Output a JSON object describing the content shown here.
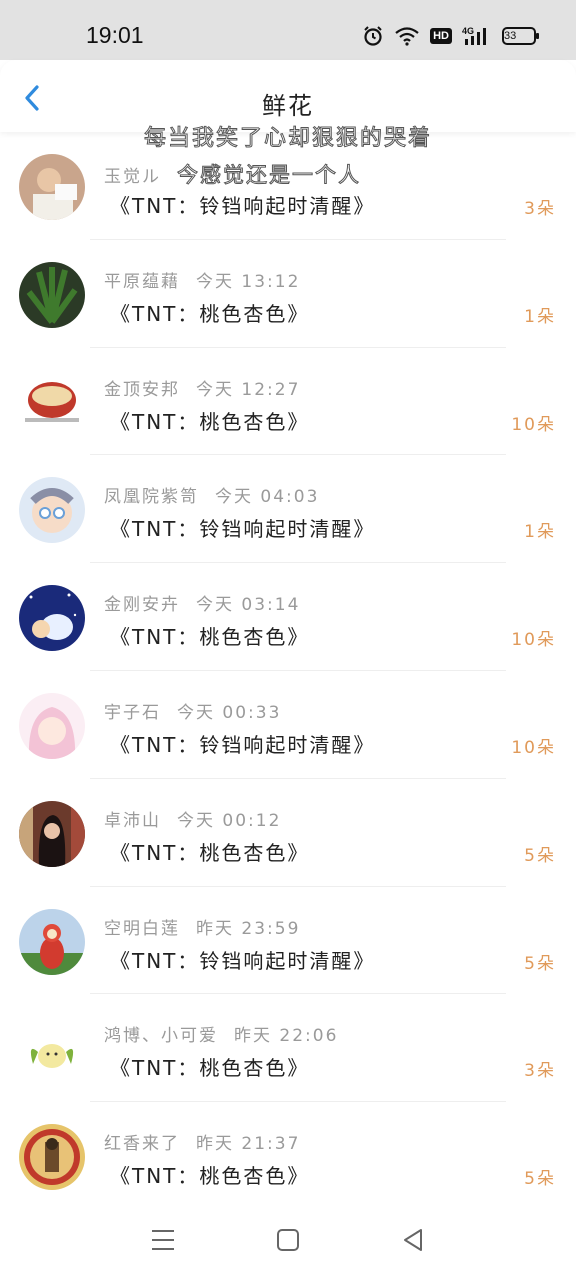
{
  "status": {
    "time": "19:01",
    "hd": "HD",
    "network": "4G",
    "battery": "33"
  },
  "header": {
    "title": "鲜花",
    "overlay_line1": "每当我笑了心却狠狠的哭着",
    "overlay_line2": "今感觉还是一个人"
  },
  "rows": [
    {
      "name": "玉觉ル",
      "time": "",
      "gift": "《TNT：铃铛响起时清醒》",
      "count": "3朵"
    },
    {
      "name": "平原蕴藉",
      "time": "今天 13:12",
      "gift": "《TNT：桃色杏色》",
      "count": "1朵"
    },
    {
      "name": "金顶安邦",
      "time": "今天 12:27",
      "gift": "《TNT：桃色杏色》",
      "count": "10朵"
    },
    {
      "name": "凤凰院紫笥",
      "time": "今天 04:03",
      "gift": "《TNT：铃铛响起时清醒》",
      "count": "1朵"
    },
    {
      "name": "金刚安卉",
      "time": "今天 03:14",
      "gift": "《TNT：桃色杏色》",
      "count": "10朵"
    },
    {
      "name": "宇子石",
      "time": "今天 00:33",
      "gift": "《TNT：铃铛响起时清醒》",
      "count": "10朵"
    },
    {
      "name": "卓沛山",
      "time": "今天 00:12",
      "gift": "《TNT：桃色杏色》",
      "count": "5朵"
    },
    {
      "name": "空明白莲",
      "time": "昨天 23:59",
      "gift": "《TNT：铃铛响起时清醒》",
      "count": "5朵"
    },
    {
      "name": "鸿博、小可爱",
      "time": "昨天 22:06",
      "gift": "《TNT：桃色杏色》",
      "count": "3朵"
    },
    {
      "name": "红香来了",
      "time": "昨天 21:37",
      "gift": "《TNT：桃色杏色》",
      "count": "5朵"
    }
  ],
  "colors": {
    "accent": "#2f8bde",
    "count": "#e09a5a",
    "meta": "#9a9a9a"
  }
}
